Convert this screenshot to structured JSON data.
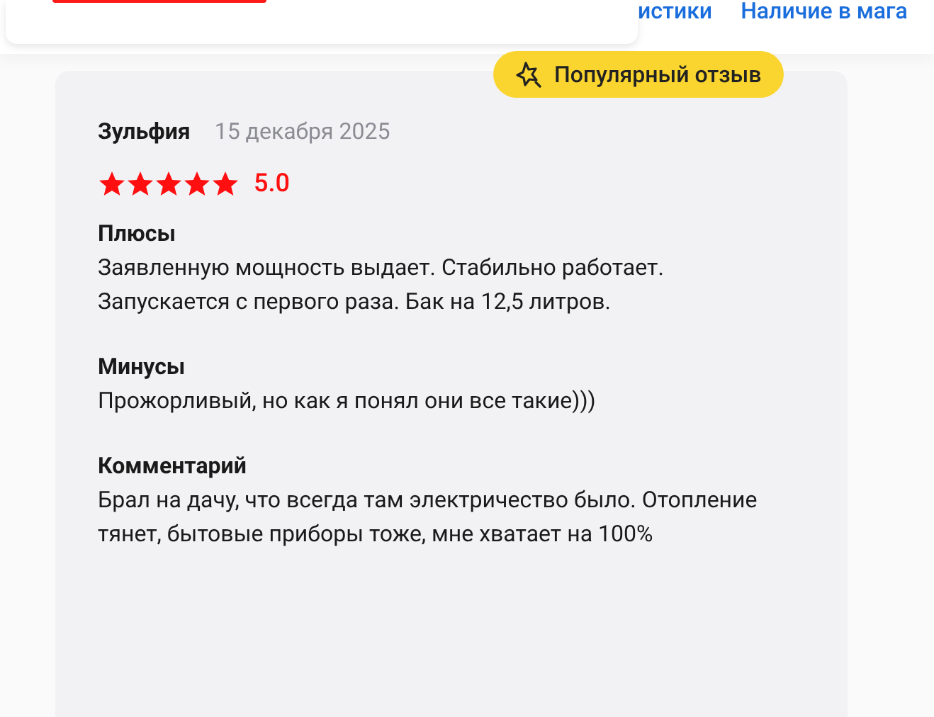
{
  "tabs": [
    {
      "label": "истики",
      "selected": false
    },
    {
      "label": "Наличие в мага",
      "selected": false
    }
  ],
  "review": {
    "badge": "Популярный отзыв",
    "author": "Зульфия",
    "date": "15 декабря 2025",
    "stars": 5,
    "rating": "5.0",
    "sections": [
      {
        "title": "Плюсы",
        "text": "Заявленную мощность выдает. Стабильно работает. Запускается с первого раза. Бак на 12,5 литров."
      },
      {
        "title": "Минусы",
        "text": "Прожорливый, но как я понял они все такие)))"
      },
      {
        "title": "Комментарий",
        "text": "Брал на дачу, что всегда там электричество было. Отопление тянет, бытовые приборы тоже, мне хватает на 100%"
      }
    ]
  }
}
